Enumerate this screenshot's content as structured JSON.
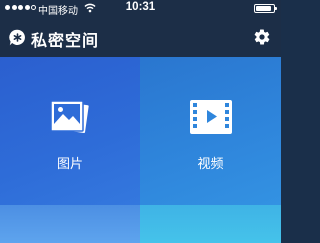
{
  "status_bar": {
    "carrier": "中国移动",
    "time": "10:31",
    "signal_bars_filled": 4,
    "signal_bars_total": 5
  },
  "nav": {
    "title": "私密空间",
    "logo_icon": "asterisk-bubble-icon",
    "settings_icon": "gear-icon"
  },
  "tiles": [
    {
      "label": "图片",
      "icon": "photo-stack-icon",
      "color": "#2e6cd8"
    },
    {
      "label": "视频",
      "icon": "video-play-icon",
      "color": "#2f86dc"
    }
  ],
  "colors": {
    "header_background": "#1c2e47",
    "bottom_left_tile": "#5ea4ee",
    "bottom_right_tile": "#45c3ea"
  }
}
